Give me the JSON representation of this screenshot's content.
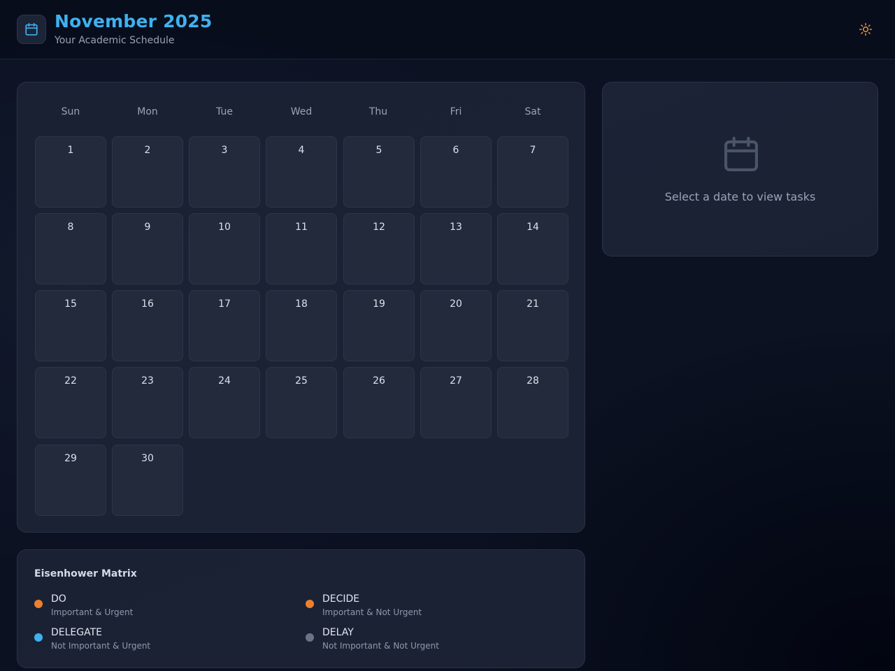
{
  "header": {
    "title": "November 2025",
    "subtitle": "Your Academic Schedule"
  },
  "colors": {
    "accent": "#3fb1ee",
    "theme_icon": "#f0923a"
  },
  "icons": {
    "logo": "calendar-icon",
    "theme_toggle": "sun-icon",
    "empty_state": "calendar-icon"
  },
  "calendar": {
    "weekdays": [
      "Sun",
      "Mon",
      "Tue",
      "Wed",
      "Thu",
      "Fri",
      "Sat"
    ],
    "days": [
      "1",
      "2",
      "3",
      "4",
      "5",
      "6",
      "7",
      "8",
      "9",
      "10",
      "11",
      "12",
      "13",
      "14",
      "15",
      "16",
      "17",
      "18",
      "19",
      "20",
      "21",
      "22",
      "23",
      "24",
      "25",
      "26",
      "27",
      "28",
      "29",
      "30"
    ]
  },
  "side_panel": {
    "empty_text": "Select a date to view tasks"
  },
  "matrix": {
    "title": "Eisenhower Matrix",
    "quadrants": [
      {
        "name": "DO",
        "desc": "Important & Urgent",
        "color": "#ee7f2d"
      },
      {
        "name": "DECIDE",
        "desc": "Important & Not Urgent",
        "color": "#ee7f2d"
      },
      {
        "name": "DELEGATE",
        "desc": "Not Important & Urgent",
        "color": "#3fb1ee"
      },
      {
        "name": "DELAY",
        "desc": "Not Important & Not Urgent",
        "color": "#6b7487"
      }
    ]
  }
}
